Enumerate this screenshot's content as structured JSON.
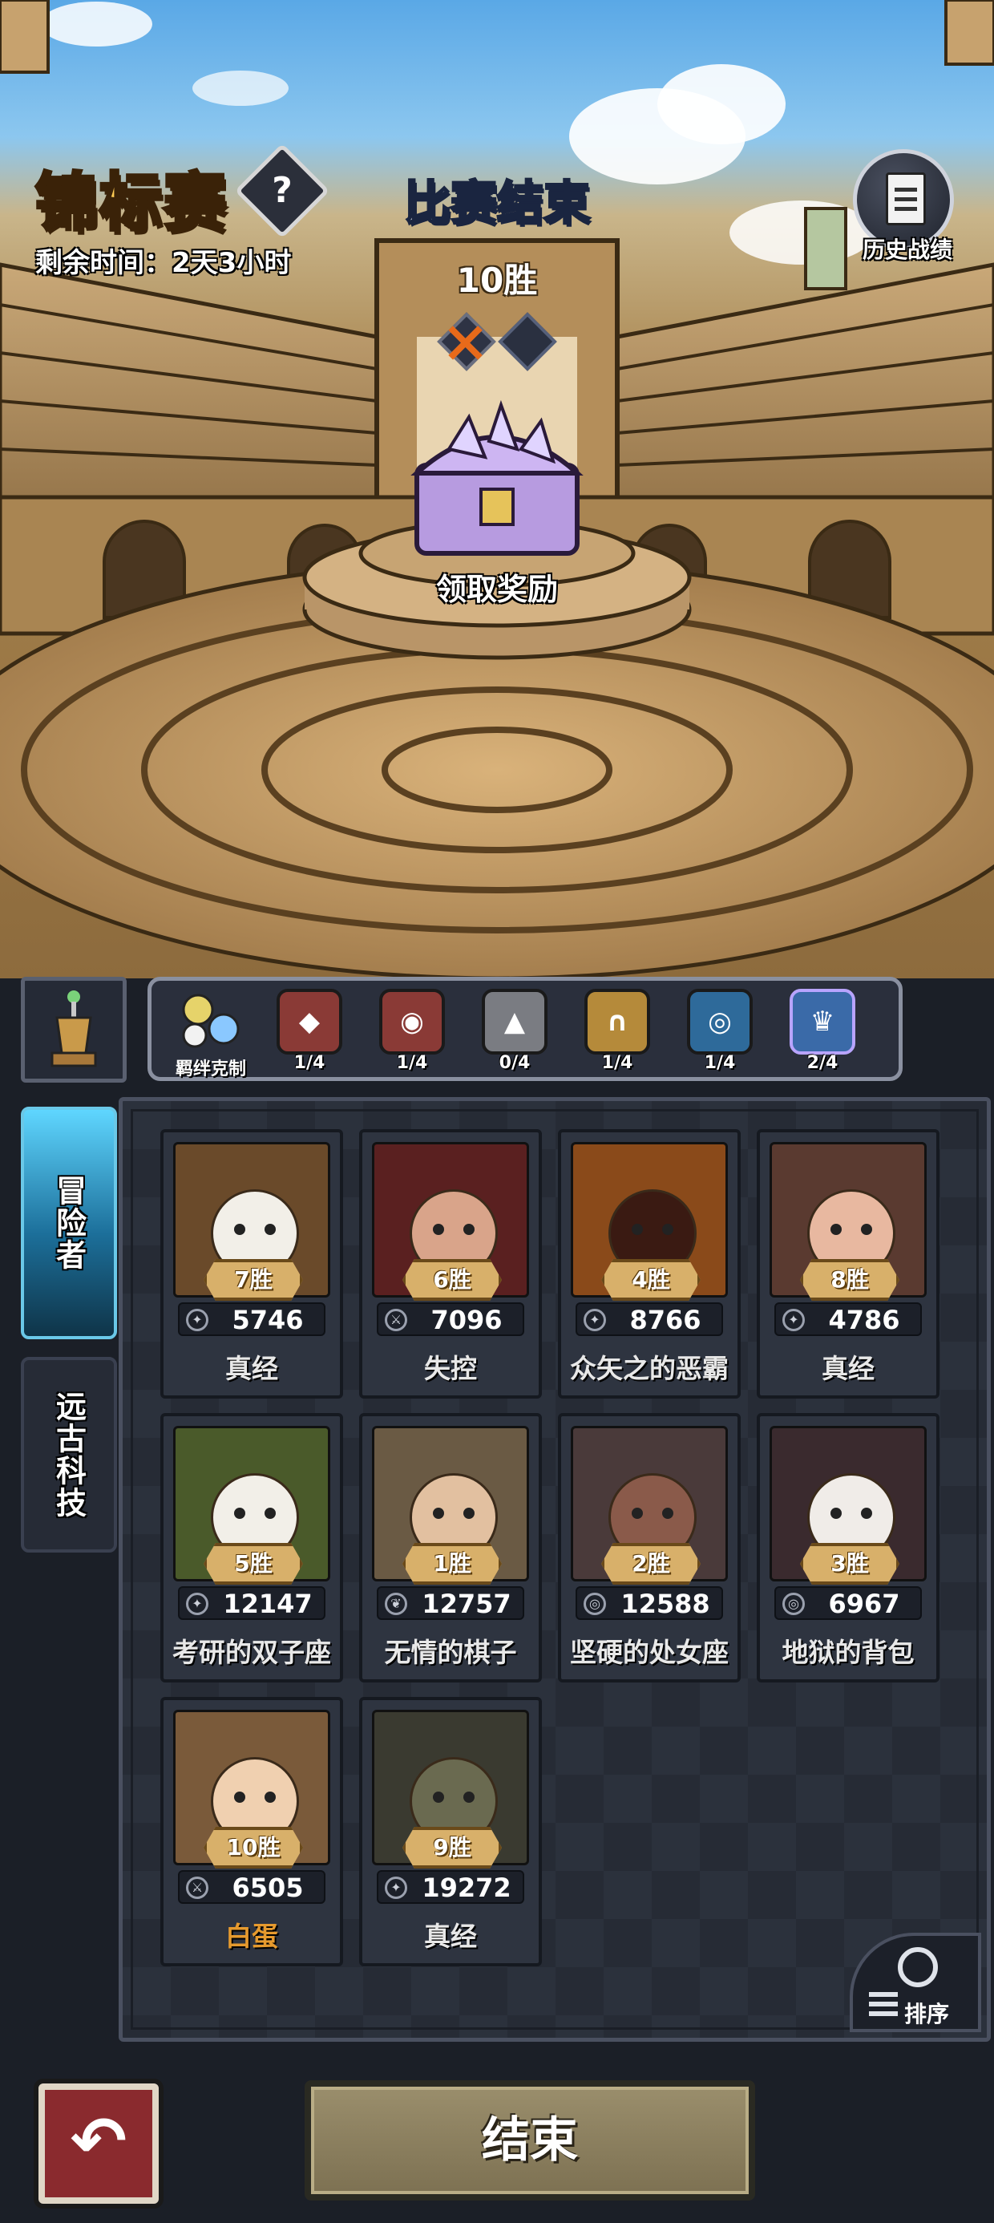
{
  "header": {
    "title": "锦标赛",
    "help_label": "?",
    "remaining_time": "剩余时间：2天3小时",
    "history_label": "历史战绩"
  },
  "match": {
    "status": "比赛结束",
    "wins": "10胜",
    "losses_shown": 1,
    "loss_slots": 2,
    "claim_label": "领取奖励"
  },
  "bonds": {
    "label": "羁绊克制",
    "items": [
      {
        "count": "1/4",
        "icon": "diamond-crest-icon",
        "color": "#8a3a36"
      },
      {
        "count": "1/4",
        "icon": "eye-crest-icon",
        "color": "#8a3a36"
      },
      {
        "count": "0/4",
        "icon": "mountain-crest-icon",
        "color": "#7a7c82"
      },
      {
        "count": "1/4",
        "icon": "arch-crest-icon",
        "color": "#b58a3a"
      },
      {
        "count": "1/4",
        "icon": "swirl-crest-icon",
        "color": "#2e6a9a"
      },
      {
        "count": "2/4",
        "icon": "crown-crest-icon",
        "color": "#3a6aa8"
      }
    ]
  },
  "tabs": {
    "adventurers": "冒险者",
    "ancient_tech": "远古科技"
  },
  "heroes": [
    {
      "wins": "7胜",
      "power": "5746",
      "name": "真经",
      "bg": "#6a4a2a",
      "stat_icon": "claw-icon"
    },
    {
      "wins": "6胜",
      "power": "7096",
      "name": "失控",
      "bg": "#5a2020",
      "stat_icon": "sword-icon"
    },
    {
      "wins": "4胜",
      "power": "8766",
      "name": "众矢之的恶霸",
      "bg": "#8a4a1a",
      "stat_icon": "claw-icon"
    },
    {
      "wins": "8胜",
      "power": "4786",
      "name": "真经",
      "bg": "#5a3a30",
      "stat_icon": "claw-icon"
    },
    {
      "wins": "5胜",
      "power": "12147",
      "name": "考研的双子座",
      "bg": "#4a5a2a",
      "stat_icon": "claw-icon"
    },
    {
      "wins": "1胜",
      "power": "12757",
      "name": "无情的棋子",
      "bg": "#6a5a44",
      "stat_icon": "leaf-icon"
    },
    {
      "wins": "2胜",
      "power": "12588",
      "name": "坚硬的处女座",
      "bg": "#4a3a3a",
      "stat_icon": "target-icon"
    },
    {
      "wins": "3胜",
      "power": "6967",
      "name": "地狱的背包",
      "bg": "#3a2a2e",
      "stat_icon": "target-icon"
    },
    {
      "wins": "10胜",
      "power": "6505",
      "name": "白蛋",
      "bg": "#7a5a3a",
      "stat_icon": "sword-icon",
      "highlight": true
    },
    {
      "wins": "9胜",
      "power": "19272",
      "name": "真经",
      "bg": "#3a3a30",
      "stat_icon": "claw-icon"
    }
  ],
  "sort_label": "排序",
  "footer": {
    "end_label": "结束"
  }
}
